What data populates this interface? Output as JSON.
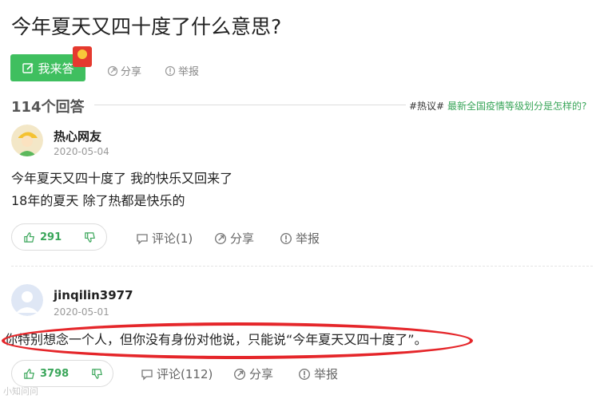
{
  "question": {
    "title": "今年夏天又四十度了什么意思?",
    "answer_button": "我来答",
    "share": "分享",
    "report": "举报"
  },
  "answers_header": {
    "count": "114个回答",
    "topic_tag": "#热议#",
    "topic_link": "最新全国疫情等级划分是怎样的?"
  },
  "answers": [
    {
      "user": "热心网友",
      "date": "2020-05-04",
      "lines": [
        "今年夏天又四十度了 我的快乐又回来了",
        "18年的夏天 除了热都是快乐的"
      ],
      "likes": "291",
      "comment": "评论(1)",
      "share": "分享",
      "report": "举报"
    },
    {
      "user": "jinqilin3977",
      "date": "2020-05-01",
      "lines": [
        "你特别想念一个人，但你没有身份对他说，只能说“今年夏天又四十度了”。"
      ],
      "likes": "3798",
      "comment": "评论(112)",
      "share": "分享",
      "report": "举报"
    }
  ],
  "watermark": "小知问问",
  "colors": {
    "accent_green": "#3fbf5f",
    "highlight_red": "#e5262a"
  },
  "icons": [
    "edit-icon",
    "red-packet-icon",
    "share-icon",
    "report-icon",
    "thumb-up-icon",
    "thumb-down-icon",
    "comment-icon"
  ]
}
